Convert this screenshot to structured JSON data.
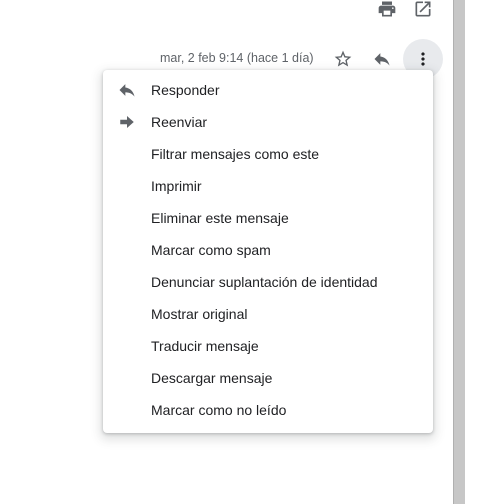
{
  "toolbar": {
    "print_icon": "print-icon",
    "open_new_window_icon": "open-in-new-icon"
  },
  "message_header": {
    "timestamp": "mar, 2 feb 9:14 (hace 1 día)",
    "star_icon": "star-outline-icon",
    "reply_icon": "reply-icon",
    "more_icon": "more-vert-icon"
  },
  "menu": {
    "items": [
      {
        "label": "Responder",
        "icon": "reply-icon"
      },
      {
        "label": "Reenviar",
        "icon": "forward-icon"
      },
      {
        "label": "Filtrar mensajes como este"
      },
      {
        "label": "Imprimir"
      },
      {
        "label": "Eliminar este mensaje"
      },
      {
        "label": "Marcar como spam"
      },
      {
        "label": "Denunciar suplantación de identidad"
      },
      {
        "label": "Mostrar original"
      },
      {
        "label": "Traducir mensaje"
      },
      {
        "label": "Descargar mensaje"
      },
      {
        "label": "Marcar como no leído"
      }
    ]
  },
  "colors": {
    "icon": "#5f6368",
    "text": "#202124",
    "timestamp": "#5f6368",
    "more_button_bg": "#e8eaed",
    "scroll_edge": "#c7c7c7"
  }
}
